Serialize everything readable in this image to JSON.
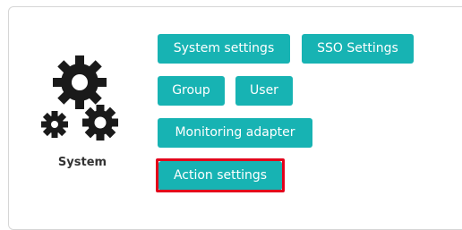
{
  "module": {
    "label": "System",
    "icon": "gears-icon"
  },
  "buttons": {
    "system_settings": "System settings",
    "sso_settings": "SSO Settings",
    "group": "Group",
    "user": "User",
    "monitoring_adapter": "Monitoring adapter",
    "action_settings": "Action settings"
  },
  "colors": {
    "button_bg": "#17b3b3",
    "button_text": "#ffffff",
    "highlight": "#e3001b"
  }
}
